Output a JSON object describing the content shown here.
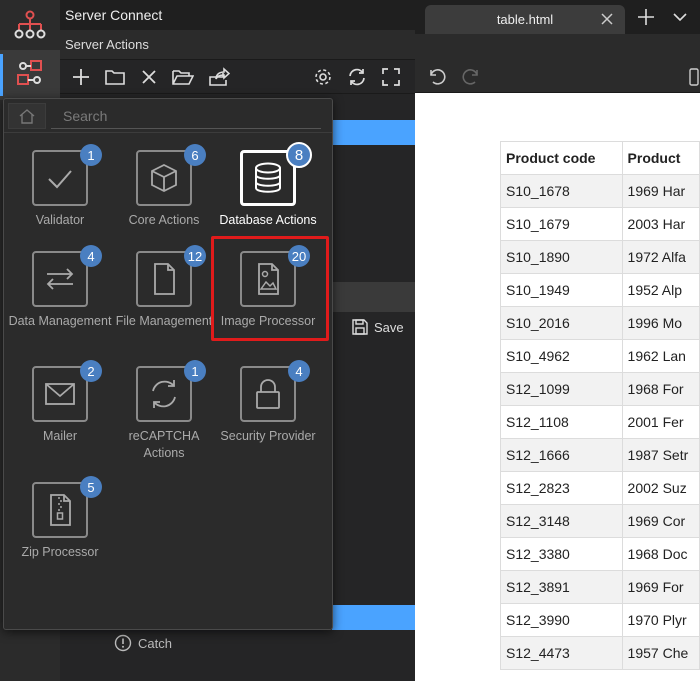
{
  "rail": {
    "items": [
      {
        "icon": "server-connect-icon"
      },
      {
        "icon": "server-actions-icon"
      }
    ],
    "accent": "#4aa3ff",
    "icon_color": "#e05050"
  },
  "panel": {
    "title": "Server Connect",
    "subtitle": "Server Actions",
    "toolbar": [
      "add-icon",
      "folder-icon",
      "delete-icon",
      "open-folder-icon",
      "export-icon",
      "gear-icon",
      "refresh-icon",
      "fullscreen-icon"
    ],
    "save_label": "Save",
    "catch_label": "Catch"
  },
  "popup": {
    "search_placeholder": "Search",
    "tiles": [
      {
        "label": "Validator",
        "count": "1",
        "icon": "check-icon"
      },
      {
        "label": "Core Actions",
        "count": "6",
        "icon": "cube-icon"
      },
      {
        "label": "Database Actions",
        "count": "8",
        "icon": "database-icon",
        "selected": true
      },
      {
        "label": "Data Management",
        "count": "4",
        "icon": "arrows-exchange-icon"
      },
      {
        "label": "File Management",
        "count": "12",
        "icon": "file-icon"
      },
      {
        "label": "Image Processor",
        "count": "20",
        "icon": "image-file-icon"
      },
      {
        "label": "Mailer",
        "count": "2",
        "icon": "envelope-icon"
      },
      {
        "label": "reCAPTCHA Actions",
        "count": "1",
        "icon": "recaptcha-icon"
      },
      {
        "label": "Security Provider",
        "count": "4",
        "icon": "lock-icon"
      },
      {
        "label": "Zip Processor",
        "count": "5",
        "icon": "zip-file-icon"
      }
    ],
    "highlight_color": "#e01b1b"
  },
  "editor": {
    "tab_label": "table.html",
    "table": {
      "headers": [
        "Product code",
        "Product"
      ],
      "rows": [
        [
          "S10_1678",
          "1969 Har"
        ],
        [
          "S10_1679",
          "2003 Har"
        ],
        [
          "S10_1890",
          "1972 Alfa"
        ],
        [
          "S10_1949",
          "1952 Alp"
        ],
        [
          "S10_2016",
          "1996 Mo"
        ],
        [
          "S10_4962",
          "1962 Lan"
        ],
        [
          "S12_1099",
          "1968 For"
        ],
        [
          "S12_1108",
          "2001 Fer"
        ],
        [
          "S12_1666",
          "1987 Setr"
        ],
        [
          "S12_2823",
          "2002 Suz"
        ],
        [
          "S12_3148",
          "1969 Cor"
        ],
        [
          "S12_3380",
          "1968 Doc"
        ],
        [
          "S12_3891",
          "1969 For"
        ],
        [
          "S12_3990",
          "1970 Plyr"
        ],
        [
          "S12_4473",
          "1957 Che"
        ]
      ]
    }
  }
}
